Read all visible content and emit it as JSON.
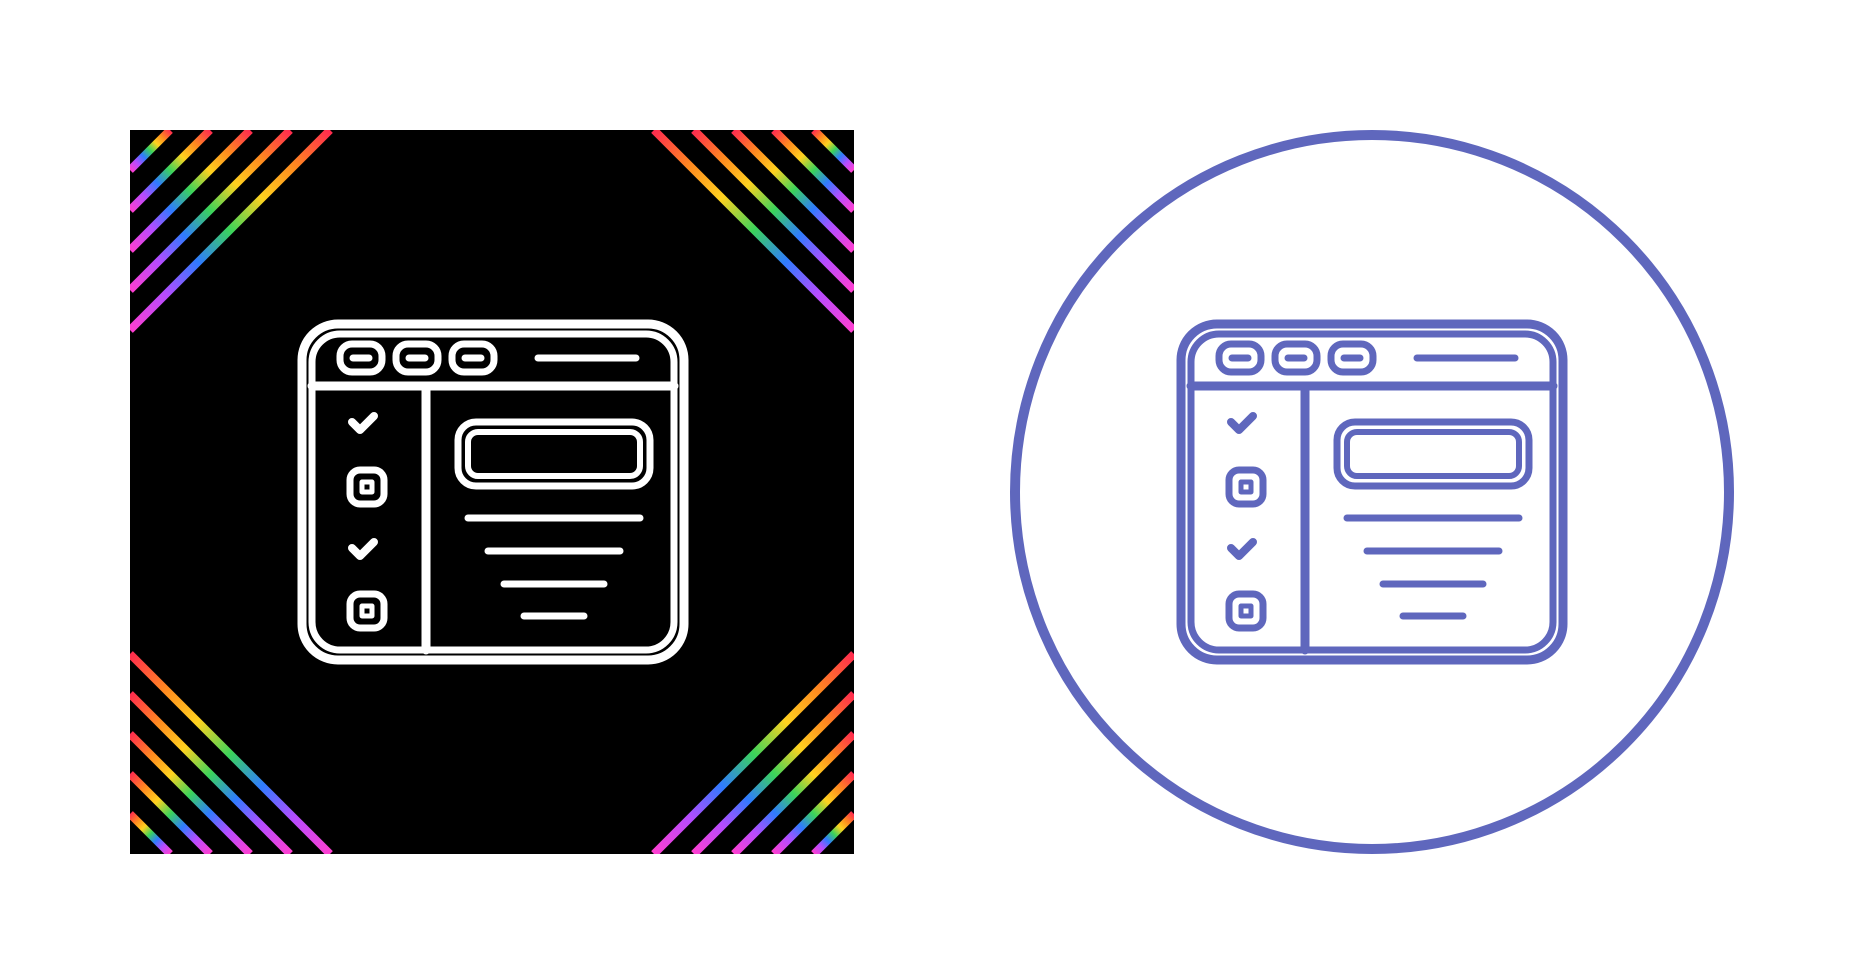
{
  "icons": [
    {
      "variant": "dark",
      "name": "browser-checklist-icon",
      "background": "#000000",
      "stroke": "#ffffff",
      "corner_decoration": "rainbow-diagonal-stripes"
    },
    {
      "variant": "outline",
      "name": "browser-checklist-icon",
      "background": "#ffffff",
      "stroke": "#5f67bd",
      "frame": "circle"
    }
  ],
  "checklist": {
    "items": [
      {
        "state": "checked"
      },
      {
        "state": "unchecked"
      },
      {
        "state": "checked"
      },
      {
        "state": "unchecked"
      }
    ]
  },
  "rainbow_colors": [
    "#ff2a4f",
    "#ff8a1f",
    "#ffd21f",
    "#3bd35a",
    "#2f7bff",
    "#b54cff",
    "#ff3fd0"
  ]
}
